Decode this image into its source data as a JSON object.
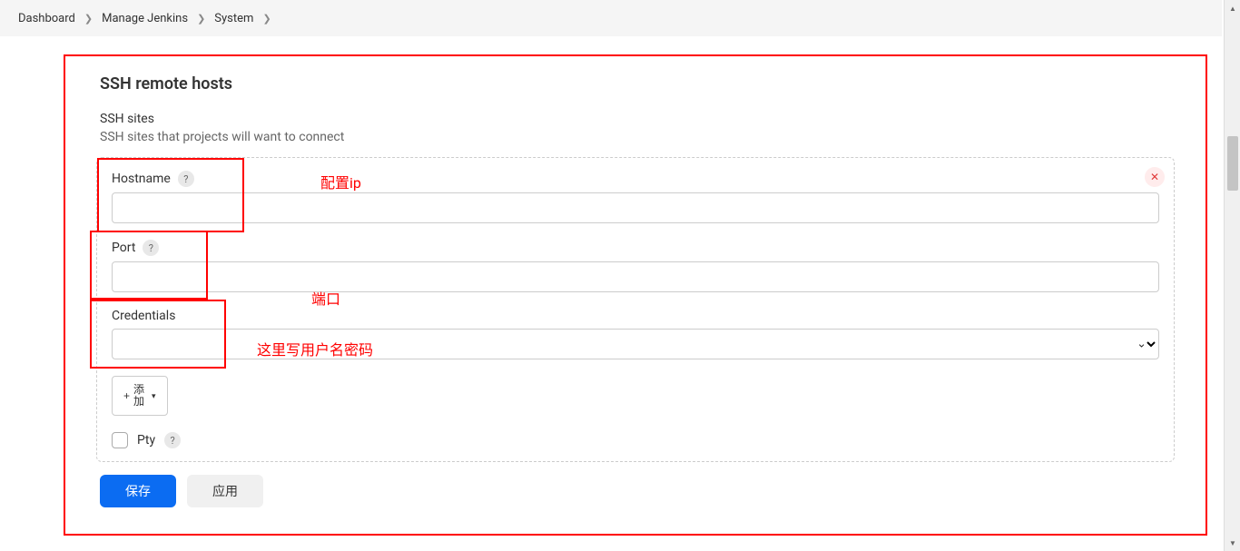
{
  "breadcrumb": {
    "items": [
      "Dashboard",
      "Manage Jenkins",
      "System"
    ]
  },
  "section": {
    "title": "SSH remote hosts",
    "subtitle": "SSH sites",
    "description": "SSH sites that projects will want to connect"
  },
  "form": {
    "hostname": {
      "label": "Hostname",
      "value": ""
    },
    "port": {
      "label": "Port",
      "value": ""
    },
    "credentials": {
      "label": "Credentials",
      "value": ""
    },
    "add_button": "添\n加",
    "pty": {
      "label": "Pty"
    }
  },
  "annotations": {
    "hostname": "配置ip",
    "port": "端口",
    "credentials": "这里写用户名密码"
  },
  "actions": {
    "save": "保存",
    "apply": "应用"
  },
  "icons": {
    "close": "✕",
    "help": "?",
    "plus": "+",
    "chevron_right": "❯",
    "chevron_down": "⌄"
  }
}
